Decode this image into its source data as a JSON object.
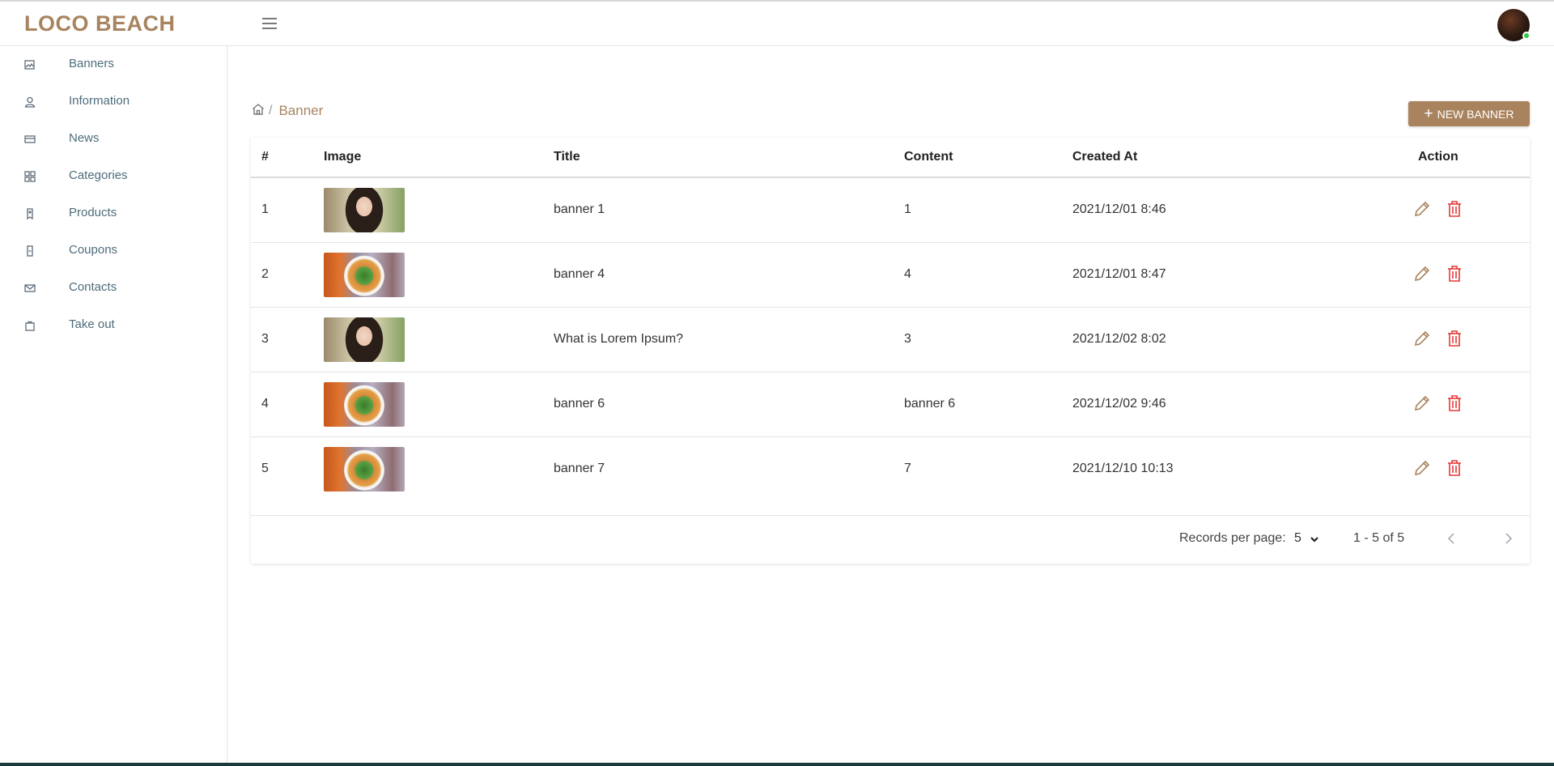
{
  "brand": {
    "name": "LOCO BEACH"
  },
  "sidebar": {
    "items": [
      {
        "label": "Banners",
        "icon": "image-icon"
      },
      {
        "label": "Information",
        "icon": "user-icon"
      },
      {
        "label": "News",
        "icon": "card-icon"
      },
      {
        "label": "Categories",
        "icon": "grid-icon"
      },
      {
        "label": "Products",
        "icon": "tag-icon"
      },
      {
        "label": "Coupons",
        "icon": "ticket-icon"
      },
      {
        "label": "Contacts",
        "icon": "mail-icon"
      },
      {
        "label": "Take out",
        "icon": "bag-icon"
      }
    ]
  },
  "breadcrumb": {
    "separator": "/",
    "current": "Banner"
  },
  "actions": {
    "new_banner_icon": "+",
    "new_banner_label": "NEW BANNER"
  },
  "table": {
    "headers": {
      "index": "#",
      "image": "Image",
      "title": "Title",
      "content": "Content",
      "created_at": "Created At",
      "action": "Action"
    },
    "rows": [
      {
        "index": "1",
        "image": "portrait",
        "title": "banner 1",
        "content": "1",
        "created_at": "2021/12/01 8:46"
      },
      {
        "index": "2",
        "image": "food",
        "title": "banner 4",
        "content": "4",
        "created_at": "2021/12/01 8:47"
      },
      {
        "index": "3",
        "image": "portrait",
        "title": "What is Lorem Ipsum?",
        "content": "3",
        "created_at": "2021/12/02 8:02"
      },
      {
        "index": "4",
        "image": "food",
        "title": "banner 6",
        "content": "banner 6",
        "created_at": "2021/12/02 9:46"
      },
      {
        "index": "5",
        "image": "food",
        "title": "banner 7",
        "content": "7",
        "created_at": "2021/12/10 10:13"
      }
    ]
  },
  "pagination": {
    "records_per_page_label": "Records per page:",
    "records_per_page_value": "5",
    "range_text": "1 - 5 of 5"
  },
  "colors": {
    "brand": "#a8835e",
    "delete": "#e53935",
    "sidebar_text": "#4d6c7b"
  }
}
